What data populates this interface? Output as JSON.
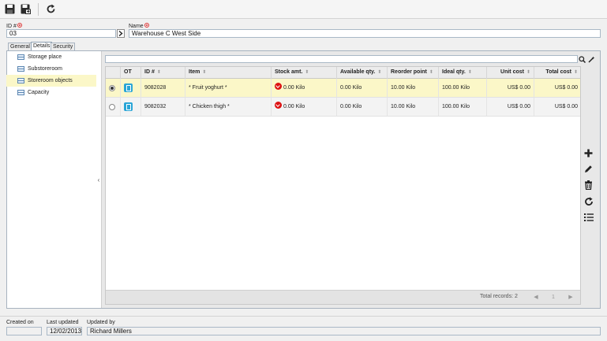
{
  "toolbar": {
    "icons": [
      "save-icon",
      "save-exit-icon",
      "refresh-icon"
    ]
  },
  "form": {
    "id_label": "ID #",
    "id_value": "03",
    "name_label": "Name",
    "name_value": "Warehouse C West Side"
  },
  "tabs": [
    {
      "label": "General"
    },
    {
      "label": "Details"
    },
    {
      "label": "Security"
    }
  ],
  "tree": {
    "items": [
      {
        "label": "Storage place"
      },
      {
        "label": "Substoreroom"
      },
      {
        "label": "Storeroom objects"
      },
      {
        "label": "Capacity"
      }
    ]
  },
  "search": {
    "value": ""
  },
  "grid": {
    "columns": {
      "ot": "OT",
      "id": "ID #",
      "item": "Item",
      "stock": "Stock amt.",
      "available": "Available qty.",
      "reorder": "Reorder point",
      "ideal": "Ideal qty.",
      "unit_cost": "Unit cost",
      "total_cost": "Total cost"
    },
    "rows": [
      {
        "selected": true,
        "id": "9082028",
        "item": "* Fruit yoghurt *",
        "stock": "0.00 Kilo",
        "available": "0.00 Kilo",
        "reorder": "10.00 Kilo",
        "ideal": "100.00 Kilo",
        "unit_cost": "US$ 0.00",
        "total_cost": "US$ 0.00"
      },
      {
        "selected": false,
        "id": "9082032",
        "item": "* Chicken thigh *",
        "stock": "0.00 Kilo",
        "available": "0.00 Kilo",
        "reorder": "10.00 Kilo",
        "ideal": "100.00 Kilo",
        "unit_cost": "US$ 0.00",
        "total_cost": "US$ 0.00"
      }
    ],
    "total_records": "Total records: 2",
    "page": "1"
  },
  "footer": {
    "created_label": "Created on",
    "created_value": "",
    "updated_label": "Last updated",
    "updated_value": "12/02/2013",
    "updated_by_label": "Updated by",
    "updated_by_value": "Richard Millers"
  },
  "colors": {
    "selected_row": "#fbf7c8",
    "stock_alert": "#d11111",
    "ot_icon": "#29a5d6"
  }
}
